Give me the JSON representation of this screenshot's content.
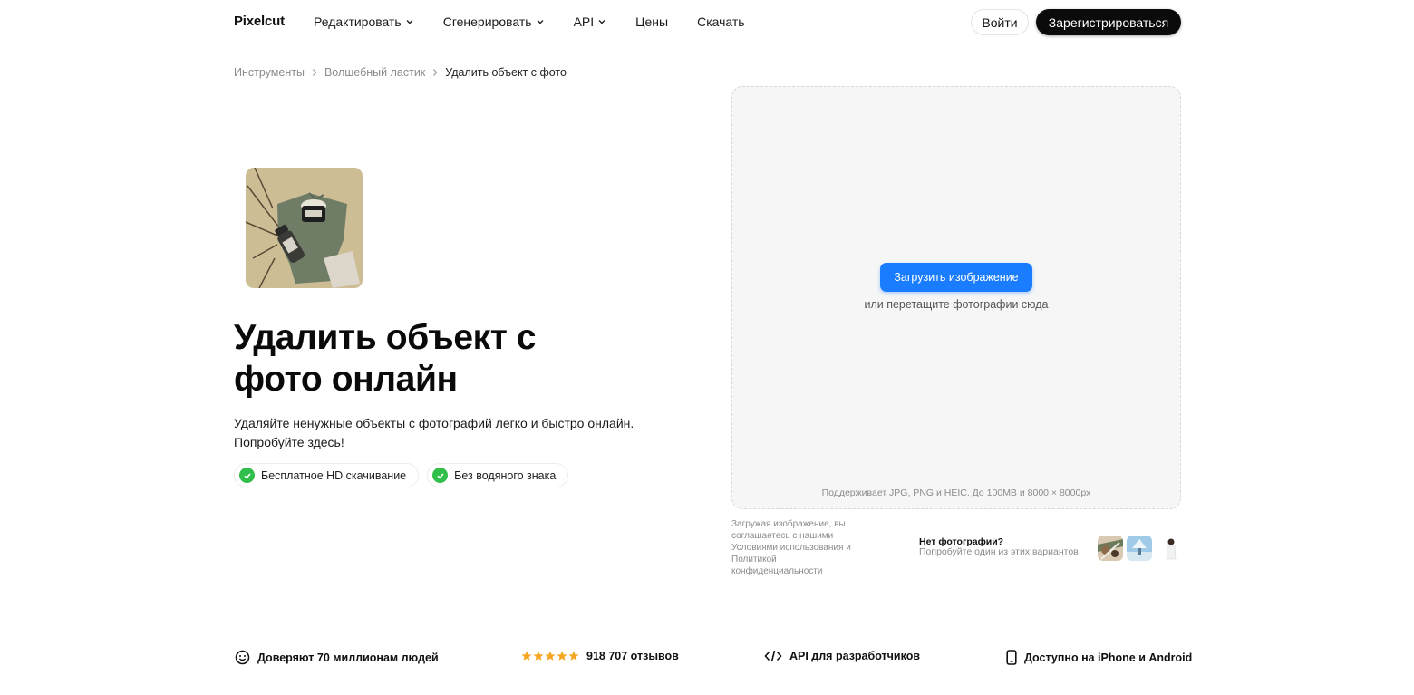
{
  "nav": {
    "logo": "Pixelcut",
    "menu": [
      {
        "label": "Редактировать",
        "has_dropdown": true
      },
      {
        "label": "Сгенерировать",
        "has_dropdown": true
      },
      {
        "label": "API",
        "has_dropdown": true
      },
      {
        "label": "Цены",
        "has_dropdown": false
      },
      {
        "label": "Скачать",
        "has_dropdown": false
      }
    ],
    "login_label": "Войти",
    "signup_label": "Зарегистрироваться"
  },
  "breadcrumb": [
    "Инструменты",
    "Волшебный ластик",
    "Удалить объект с фото"
  ],
  "hero": {
    "title": "Удалить объект с фото онлайн",
    "subtitle": "Удаляйте ненужные объекты с фотографий легко и быстро онлайн. Попробуйте здесь!",
    "chips": [
      "Бесплатное HD скачивание",
      "Без водяного знака"
    ]
  },
  "upload": {
    "button_label": "Загрузить изображение",
    "hint": "или перетащите фотографии сюда",
    "formats": "Поддерживает JPG, PNG и HEIC. До 100MB и 8000 × 8000px",
    "terms": "Загружая изображение, вы соглашаетесь с нашими Условиями использования и Политикой конфиденциальности",
    "no_photo_title": "Нет фотографии?",
    "no_photo_sub": "Попробуйте один из этих вариантов"
  },
  "stats": [
    {
      "icon": "smile-icon",
      "label": "Доверяют 70 миллионам людей"
    },
    {
      "icon": "stars-icon",
      "label": "918 707 отзывов",
      "rating": 5
    },
    {
      "icon": "code-icon",
      "label": "API для разработчиков"
    },
    {
      "icon": "phone-icon",
      "label": "Доступно на iPhone и Android"
    }
  ],
  "colors": {
    "accent": "#1a7cff",
    "check": "#2fbf4a",
    "star": "#f5a623",
    "dark": "#0b0b0b"
  }
}
